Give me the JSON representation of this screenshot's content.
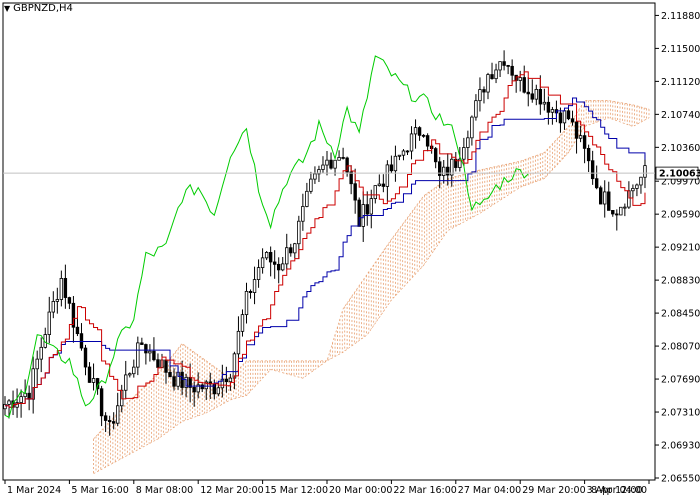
{
  "chart_title": "GBPNZD,H4",
  "current_price": "2.10063",
  "colors": {
    "background": "#ffffff",
    "axis": "#000000",
    "candle": "#000000",
    "tenkan": "#cc0000",
    "kijun": "#0000aa",
    "chikou": "#00cc00",
    "kumo": "#e8a070",
    "price_line": "#c0c0c0",
    "price_tag_bg": "#ffffff"
  },
  "chart_data": {
    "type": "line",
    "symbol": "GBPNZD",
    "timeframe": "H4",
    "ylim": [
      2.0655,
      2.12
    ],
    "y_ticks": [
      "2.11880",
      "2.11500",
      "2.11120",
      "2.10740",
      "2.10360",
      "2.09970",
      "2.09590",
      "2.09210",
      "2.08830",
      "2.08450",
      "2.08070",
      "2.07690",
      "2.07310",
      "2.06930",
      "2.06550"
    ],
    "y_tick_values": [
      2.1188,
      2.115,
      2.1112,
      2.1074,
      2.1036,
      2.0997,
      2.0959,
      2.0921,
      2.0883,
      2.0845,
      2.0807,
      2.0769,
      2.0731,
      2.0693,
      2.0655
    ],
    "x_labels": [
      "1 Mar 2024",
      "5 Mar 16:00",
      "8 Mar 08:00",
      "12 Mar 20:00",
      "15 Mar 12:00",
      "20 Mar 00:00",
      "22 Mar 16:00",
      "27 Mar 04:00",
      "29 Mar 20:00",
      "3 Apr 12:00",
      "8 Apr 04:00"
    ],
    "bar_count": 160,
    "x_label_bars": [
      0,
      16,
      32,
      48,
      64,
      80,
      96,
      112,
      128,
      144,
      160
    ],
    "close_anchors": [
      [
        0,
        2.074
      ],
      [
        6,
        2.0755
      ],
      [
        10,
        2.0825
      ],
      [
        14,
        2.0885
      ],
      [
        18,
        2.082
      ],
      [
        22,
        2.076
      ],
      [
        26,
        2.071
      ],
      [
        30,
        2.077
      ],
      [
        34,
        2.081
      ],
      [
        38,
        2.079
      ],
      [
        42,
        2.077
      ],
      [
        46,
        2.076
      ],
      [
        52,
        2.076
      ],
      [
        56,
        2.078
      ],
      [
        60,
        2.086
      ],
      [
        64,
        2.091
      ],
      [
        68,
        2.09
      ],
      [
        72,
        2.093
      ],
      [
        76,
        2.099
      ],
      [
        80,
        2.102
      ],
      [
        84,
        2.103
      ],
      [
        88,
        2.095
      ],
      [
        92,
        2.099
      ],
      [
        96,
        2.101
      ],
      [
        100,
        2.104
      ],
      [
        104,
        2.106
      ],
      [
        108,
        2.1
      ],
      [
        112,
        2.102
      ],
      [
        116,
        2.107
      ],
      [
        120,
        2.112
      ],
      [
        124,
        2.114
      ],
      [
        128,
        2.111
      ],
      [
        132,
        2.11
      ],
      [
        136,
        2.108
      ],
      [
        140,
        2.107
      ],
      [
        144,
        2.103
      ],
      [
        148,
        2.098
      ],
      [
        152,
        2.0965
      ],
      [
        156,
        2.099
      ],
      [
        159,
        2.1006
      ]
    ],
    "chikou_anchors": [
      [
        0,
        2.072
      ],
      [
        5,
        2.076
      ],
      [
        8,
        2.082
      ],
      [
        12,
        2.08
      ],
      [
        16,
        2.079
      ],
      [
        20,
        2.074
      ],
      [
        24,
        2.076
      ],
      [
        28,
        2.081
      ],
      [
        32,
        2.084
      ],
      [
        35,
        2.091
      ],
      [
        40,
        2.092
      ],
      [
        44,
        2.098
      ],
      [
        48,
        2.099
      ],
      [
        52,
        2.096
      ],
      [
        56,
        2.103
      ],
      [
        60,
        2.106
      ],
      [
        63,
        2.099
      ],
      [
        66,
        2.095
      ],
      [
        70,
        2.1
      ],
      [
        74,
        2.102
      ],
      [
        78,
        2.106
      ],
      [
        82,
        2.103
      ],
      [
        85,
        2.108
      ],
      [
        88,
        2.105
      ],
      [
        92,
        2.114
      ],
      [
        96,
        2.112
      ],
      [
        100,
        2.11
      ],
      [
        104,
        2.109
      ],
      [
        108,
        2.107
      ],
      [
        112,
        2.105
      ],
      [
        116,
        2.097
      ],
      [
        118,
        2.0965
      ],
      [
        122,
        2.099
      ],
      [
        126,
        2.1005
      ],
      [
        130,
        2.101
      ]
    ],
    "cloud_anchors": [
      [
        22,
        2.066,
        2.07
      ],
      [
        30,
        2.068,
        2.074
      ],
      [
        38,
        2.07,
        2.0775
      ],
      [
        44,
        2.072,
        2.081
      ],
      [
        50,
        2.073,
        2.079
      ],
      [
        56,
        2.0745,
        2.077
      ],
      [
        60,
        2.075,
        2.079
      ],
      [
        66,
        2.078,
        2.079
      ],
      [
        74,
        2.077,
        2.079
      ],
      [
        80,
        2.079,
        2.079
      ],
      [
        84,
        2.08,
        2.085
      ],
      [
        90,
        2.082,
        2.089
      ],
      [
        96,
        2.086,
        2.093
      ],
      [
        104,
        2.09,
        2.098
      ],
      [
        110,
        2.094,
        2.1
      ],
      [
        118,
        2.096,
        2.101
      ],
      [
        128,
        2.099,
        2.102
      ],
      [
        134,
        2.1,
        2.103
      ],
      [
        140,
        2.103,
        2.106
      ],
      [
        144,
        2.106,
        2.109
      ],
      [
        150,
        2.107,
        2.109
      ],
      [
        156,
        2.106,
        2.1085
      ],
      [
        160,
        2.107,
        2.108
      ]
    ]
  }
}
